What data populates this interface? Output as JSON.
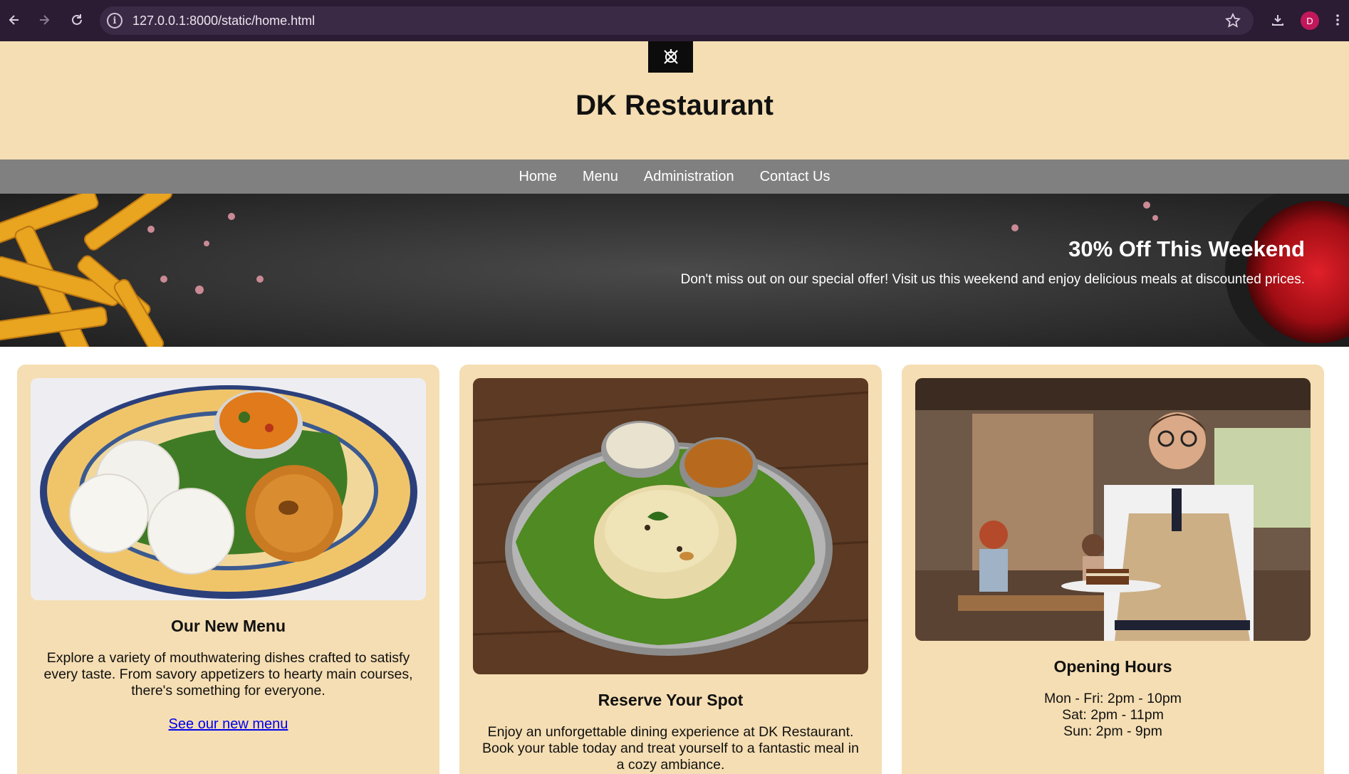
{
  "browser": {
    "url": "127.0.0.1:8000/static/home.html",
    "profile_initial": "D"
  },
  "header": {
    "title": "DK Restaurant"
  },
  "nav": {
    "items": [
      "Home",
      "Menu",
      "Administration",
      "Contact Us"
    ]
  },
  "banner": {
    "title": "30% Off This Weekend",
    "description": "Don't miss out on our special offer! Visit us this weekend and enjoy delicious meals at discounted prices."
  },
  "cards": [
    {
      "title": "Our New Menu",
      "description": "Explore a variety of mouthwatering dishes crafted to satisfy every taste. From savory appetizers to hearty main courses, there's something for everyone.",
      "link": "See our new menu"
    },
    {
      "title": "Reserve Your Spot",
      "description": "Enjoy an unforgettable dining experience at DK Restaurant. Book your table today and treat yourself to a fantastic meal in a cozy ambiance."
    },
    {
      "title": "Opening Hours",
      "hours": [
        "Mon - Fri: 2pm - 10pm",
        "Sat: 2pm - 11pm",
        "Sun: 2pm - 9pm"
      ]
    }
  ],
  "colors": {
    "header_bg": "#f5deb3",
    "nav_bg": "#808080",
    "card_bg": "#f5deb3",
    "link": "#0000ee"
  }
}
